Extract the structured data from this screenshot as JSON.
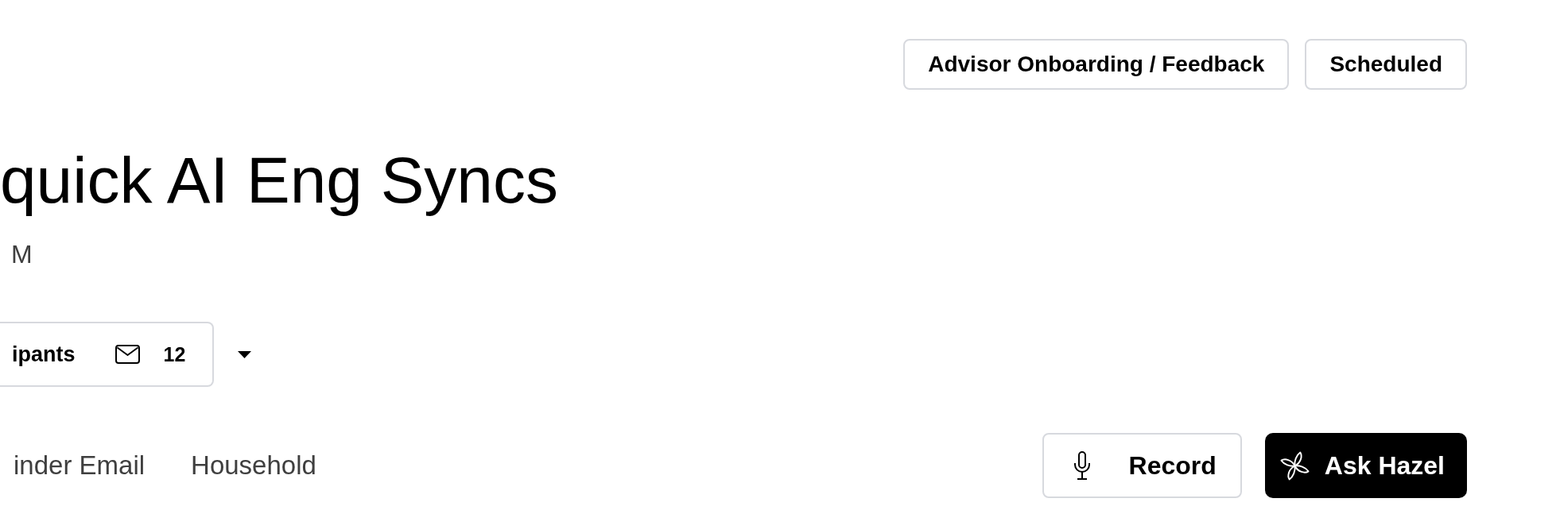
{
  "tags": [
    {
      "label": "Advisor Onboarding / Feedback"
    },
    {
      "label": "Scheduled"
    }
  ],
  "meeting": {
    "title": "quick AI Eng Syncs",
    "time": "M"
  },
  "participants": {
    "label": "ipants",
    "email_count": "12"
  },
  "links": [
    {
      "label": "inder Email"
    },
    {
      "label": "Household"
    }
  ],
  "actions": [
    {
      "kind": "record",
      "label": "Record"
    },
    {
      "kind": "ask",
      "label": "Ask Hazel"
    }
  ]
}
